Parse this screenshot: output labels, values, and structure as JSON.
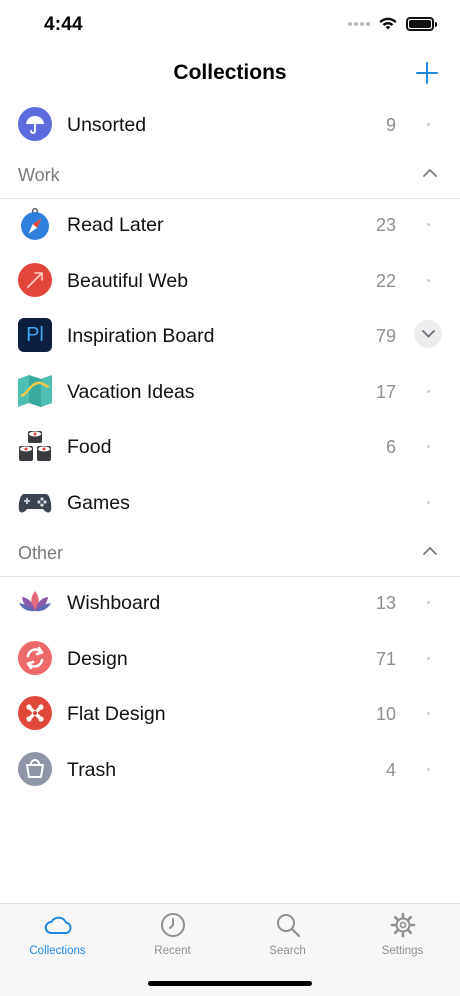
{
  "status": {
    "time": "4:44"
  },
  "nav": {
    "title": "Collections"
  },
  "top_items": [
    {
      "label": "Unsorted",
      "count": "9",
      "icon": "umbrella-icon",
      "color": "#5c6bde"
    }
  ],
  "sections": [
    {
      "title": "Work",
      "collapsed": false,
      "items": [
        {
          "label": "Read Later",
          "count": "23",
          "icon": "compass-icon"
        },
        {
          "label": "Beautiful Web",
          "count": "22",
          "icon": "arrow-icon",
          "color": "#e2463a"
        },
        {
          "label": "Inspiration Board",
          "count": "79",
          "icon": "pl-logo-icon",
          "logo_text": "Pl",
          "color": "#0c1f3f",
          "logo_color": "#3ea8f5",
          "has_children": true
        },
        {
          "label": "Vacation Ideas",
          "count": "17",
          "icon": "map-icon"
        },
        {
          "label": "Food",
          "count": "6",
          "icon": "sushi-icon"
        },
        {
          "label": "Games",
          "count": "",
          "icon": "gamepad-icon"
        }
      ]
    },
    {
      "title": "Other",
      "collapsed": false,
      "items": [
        {
          "label": "Wishboard",
          "count": "13",
          "icon": "lotus-icon"
        },
        {
          "label": "Design",
          "count": "71",
          "icon": "sync-icon",
          "color": "#ee6a6a"
        },
        {
          "label": "Flat Design",
          "count": "10",
          "icon": "joomla-icon",
          "color": "#e0483a"
        },
        {
          "label": "Trash",
          "count": "4",
          "icon": "trash-icon",
          "color": "#8e96a8"
        }
      ]
    }
  ],
  "tabs": [
    {
      "label": "Collections",
      "icon": "cloud-icon",
      "active": true
    },
    {
      "label": "Recent",
      "icon": "clock-icon",
      "active": false
    },
    {
      "label": "Search",
      "icon": "search-icon",
      "active": false
    },
    {
      "label": "Settings",
      "icon": "gear-icon",
      "active": false
    }
  ],
  "colors": {
    "accent": "#1e88e5",
    "muted": "#8e8e93"
  }
}
